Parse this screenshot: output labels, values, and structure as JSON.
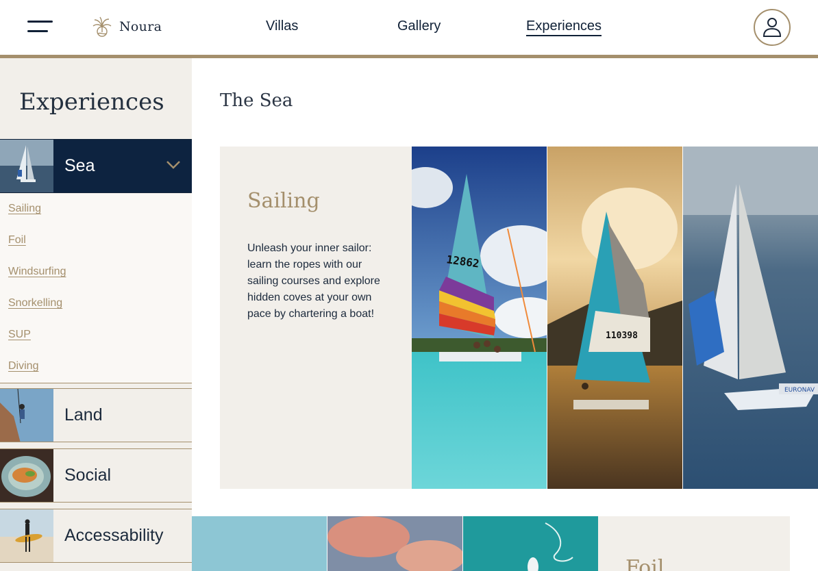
{
  "header": {
    "brand": "Noura",
    "nav": [
      {
        "label": "Villas",
        "active": false
      },
      {
        "label": "Gallery",
        "active": false
      },
      {
        "label": "Experiences",
        "active": true
      }
    ],
    "menu_icon": "hamburger-icon",
    "account_icon": "user-icon"
  },
  "sidebar": {
    "title": "Experiences",
    "categories": [
      {
        "label": "Sea",
        "expanded": true,
        "icon": "chevron-down-icon"
      },
      {
        "label": "Land"
      },
      {
        "label": "Social"
      },
      {
        "label": "Accessability"
      }
    ],
    "sea_items": [
      "Sailing",
      "Foil",
      "Windsurfing",
      "Snorkelling",
      "SUP",
      "Diving"
    ]
  },
  "main": {
    "section_title": "The Sea",
    "cards": [
      {
        "title": "Sailing",
        "description": "Unleash your inner sailor: learn the ropes with our sailing courses and explore hidden coves at your own pace by chartering a boat!"
      },
      {
        "title": "Foil"
      }
    ]
  },
  "colors": {
    "navy": "#0d2340",
    "gold": "#a48f6c",
    "cream": "#f2efea"
  }
}
